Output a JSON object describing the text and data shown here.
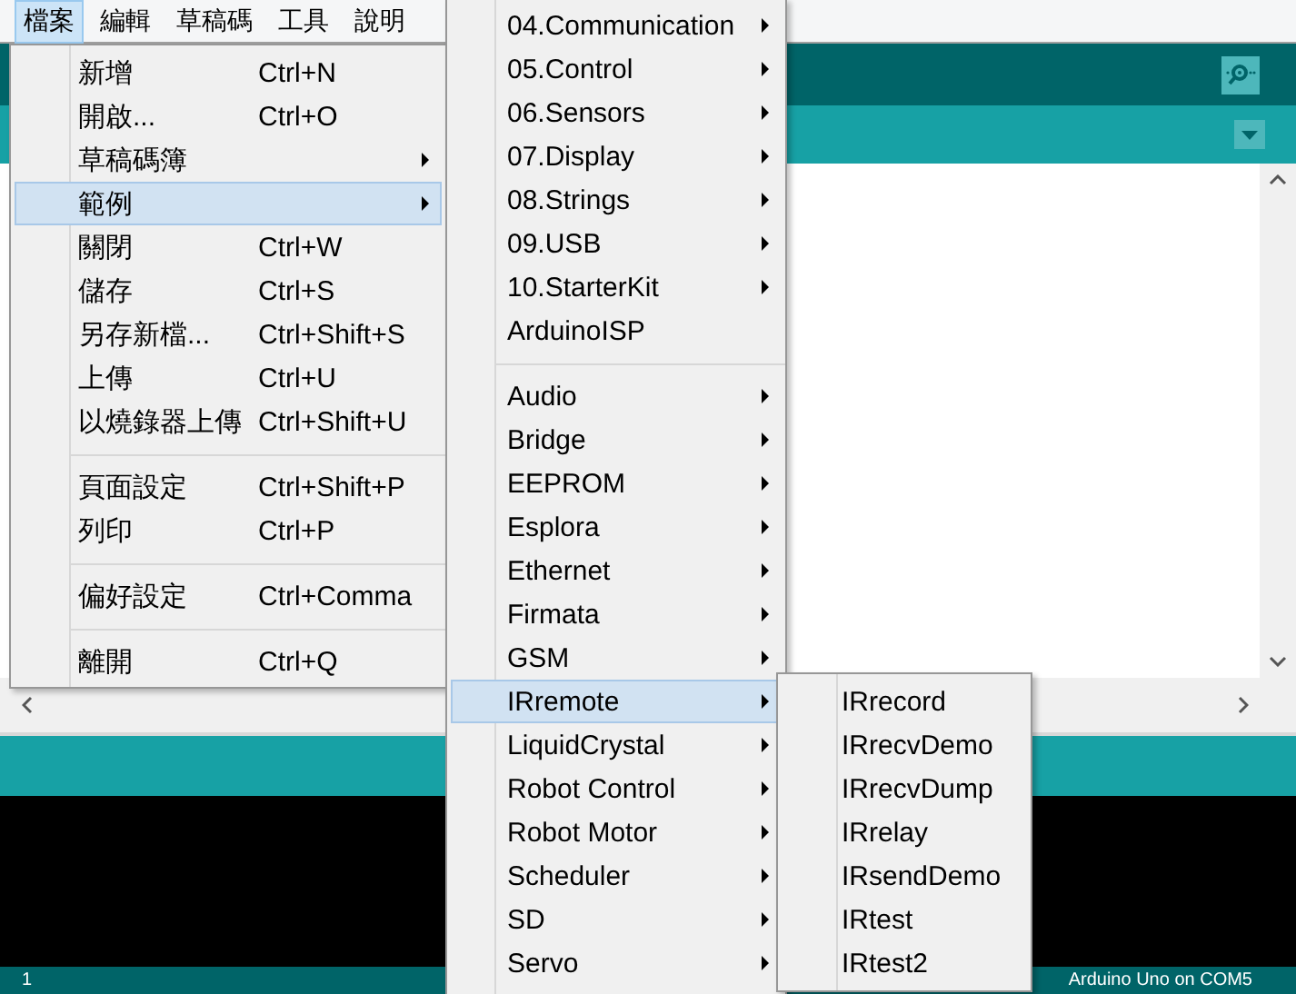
{
  "menu_bar": [
    {
      "label": "檔案",
      "selected": true
    },
    {
      "label": "編輯",
      "selected": false
    },
    {
      "label": "草稿碼",
      "selected": false
    },
    {
      "label": "工具",
      "selected": false
    },
    {
      "label": "說明",
      "selected": false
    }
  ],
  "file_menu": {
    "items": [
      {
        "kind": "item",
        "label": "新增",
        "shortcut": "Ctrl+N",
        "submenu": false,
        "selected": false
      },
      {
        "kind": "item",
        "label": "開啟...",
        "shortcut": "Ctrl+O",
        "submenu": false,
        "selected": false
      },
      {
        "kind": "item",
        "label": "草稿碼簿",
        "submenu": true,
        "selected": false
      },
      {
        "kind": "item",
        "label": "範例",
        "submenu": true,
        "selected": true
      },
      {
        "kind": "item",
        "label": "關閉",
        "shortcut": "Ctrl+W",
        "submenu": false,
        "selected": false
      },
      {
        "kind": "item",
        "label": "儲存",
        "shortcut": "Ctrl+S",
        "submenu": false,
        "selected": false
      },
      {
        "kind": "item",
        "label": "另存新檔...",
        "shortcut": "Ctrl+Shift+S",
        "submenu": false,
        "selected": false
      },
      {
        "kind": "item",
        "label": "上傳",
        "shortcut": "Ctrl+U",
        "submenu": false,
        "selected": false
      },
      {
        "kind": "item",
        "label": "以燒錄器上傳",
        "shortcut": "Ctrl+Shift+U",
        "submenu": false,
        "selected": false
      },
      {
        "kind": "separator"
      },
      {
        "kind": "item",
        "label": "頁面設定",
        "shortcut": "Ctrl+Shift+P",
        "submenu": false,
        "selected": false
      },
      {
        "kind": "item",
        "label": "列印",
        "shortcut": "Ctrl+P",
        "submenu": false,
        "selected": false
      },
      {
        "kind": "separator"
      },
      {
        "kind": "item",
        "label": "偏好設定",
        "shortcut": "Ctrl+Comma",
        "submenu": false,
        "selected": false
      },
      {
        "kind": "separator"
      },
      {
        "kind": "item",
        "label": "離開",
        "shortcut": "Ctrl+Q",
        "submenu": false,
        "selected": false
      }
    ]
  },
  "examples_menu": {
    "items": [
      {
        "kind": "item",
        "label": "04.Communication",
        "submenu": true,
        "selected": false
      },
      {
        "kind": "item",
        "label": "05.Control",
        "submenu": true,
        "selected": false
      },
      {
        "kind": "item",
        "label": "06.Sensors",
        "submenu": true,
        "selected": false
      },
      {
        "kind": "item",
        "label": "07.Display",
        "submenu": true,
        "selected": false
      },
      {
        "kind": "item",
        "label": "08.Strings",
        "submenu": true,
        "selected": false
      },
      {
        "kind": "item",
        "label": "09.USB",
        "submenu": true,
        "selected": false
      },
      {
        "kind": "item",
        "label": "10.StarterKit",
        "submenu": true,
        "selected": false
      },
      {
        "kind": "item",
        "label": "ArduinoISP",
        "submenu": false,
        "selected": false
      },
      {
        "kind": "separator"
      },
      {
        "kind": "item",
        "label": "Audio",
        "submenu": true,
        "selected": false
      },
      {
        "kind": "item",
        "label": "Bridge",
        "submenu": true,
        "selected": false
      },
      {
        "kind": "item",
        "label": "EEPROM",
        "submenu": true,
        "selected": false
      },
      {
        "kind": "item",
        "label": "Esplora",
        "submenu": true,
        "selected": false
      },
      {
        "kind": "item",
        "label": "Ethernet",
        "submenu": true,
        "selected": false
      },
      {
        "kind": "item",
        "label": "Firmata",
        "submenu": true,
        "selected": false
      },
      {
        "kind": "item",
        "label": "GSM",
        "submenu": true,
        "selected": false
      },
      {
        "kind": "item",
        "label": "IRremote",
        "submenu": true,
        "selected": true
      },
      {
        "kind": "item",
        "label": "LiquidCrystal",
        "submenu": true,
        "selected": false
      },
      {
        "kind": "item",
        "label": "Robot Control",
        "submenu": true,
        "selected": false
      },
      {
        "kind": "item",
        "label": "Robot Motor",
        "submenu": true,
        "selected": false
      },
      {
        "kind": "item",
        "label": "Scheduler",
        "submenu": true,
        "selected": false
      },
      {
        "kind": "item",
        "label": "SD",
        "submenu": true,
        "selected": false
      },
      {
        "kind": "item",
        "label": "Servo",
        "submenu": true,
        "selected": false
      }
    ]
  },
  "irremote_menu": {
    "items": [
      {
        "kind": "item",
        "label": "IRrecord",
        "submenu": false,
        "selected": false
      },
      {
        "kind": "item",
        "label": "IRrecvDemo",
        "submenu": false,
        "selected": false
      },
      {
        "kind": "item",
        "label": "IRrecvDump",
        "submenu": false,
        "selected": false
      },
      {
        "kind": "item",
        "label": "IRrelay",
        "submenu": false,
        "selected": false
      },
      {
        "kind": "item",
        "label": "IRsendDemo",
        "submenu": false,
        "selected": false
      },
      {
        "kind": "item",
        "label": "IRtest",
        "submenu": false,
        "selected": false
      },
      {
        "kind": "item",
        "label": "IRtest2",
        "submenu": false,
        "selected": false
      }
    ]
  },
  "status_bar": {
    "line": "1",
    "board": "Arduino Uno on COM5"
  }
}
